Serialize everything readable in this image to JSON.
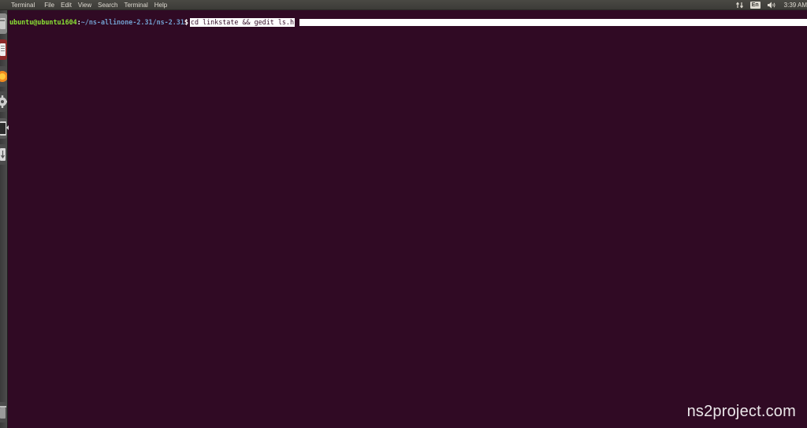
{
  "panel": {
    "app_name": "Terminal",
    "menu": [
      {
        "label": "File"
      },
      {
        "label": "Edit"
      },
      {
        "label": "View"
      },
      {
        "label": "Search"
      },
      {
        "label": "Terminal"
      },
      {
        "label": "Help"
      }
    ],
    "indicators": {
      "network_icon": "network-updown-icon",
      "keyboard_layout": "En",
      "volume_icon": "speaker-volume-icon",
      "clock": "3:39 AM"
    }
  },
  "launcher": {
    "items": [
      {
        "icon": "files-icon"
      },
      {
        "icon": "text-editor-icon"
      },
      {
        "icon": "firefox-icon"
      },
      {
        "icon": "system-settings-icon"
      },
      {
        "icon": "terminal-icon"
      },
      {
        "icon": "software-updater-icon"
      },
      {
        "icon": "trash-icon"
      }
    ],
    "colors": {
      "background": "#3a3a3a"
    }
  },
  "terminal": {
    "prompt": {
      "user_host": "ubuntu@ubuntu1604",
      "separator": ":",
      "path": "~/ns-allinone-2.31/ns-2.31",
      "symbol": "$"
    },
    "command": "cd linkstate && gedit ls.h",
    "colors": {
      "background": "#300a24",
      "user_host": "#8ae234",
      "path": "#729fcf",
      "text": "#ffffff"
    }
  },
  "watermark": {
    "text": "ns2project.com"
  }
}
